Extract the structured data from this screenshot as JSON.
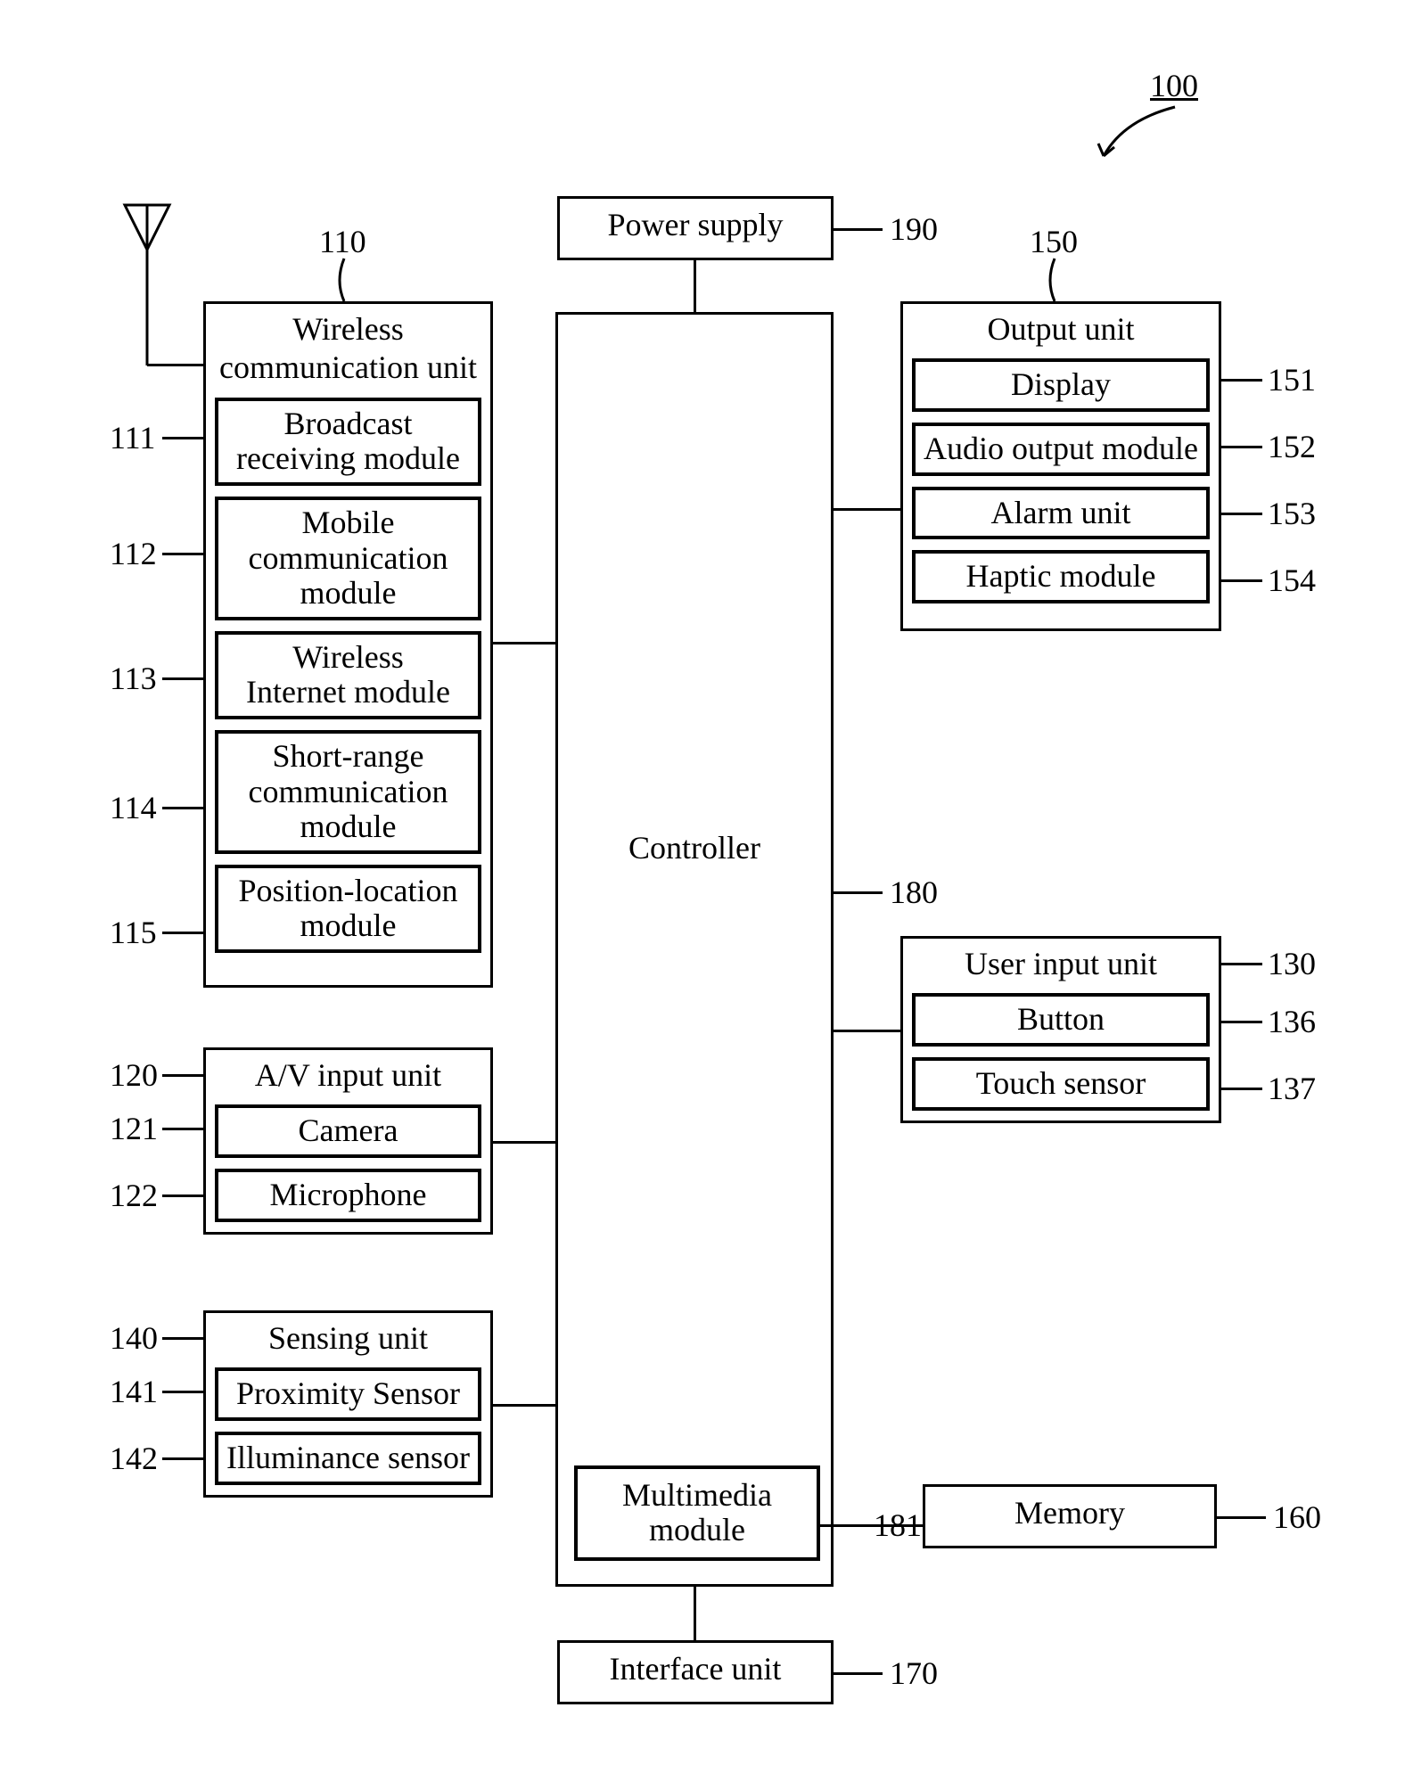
{
  "ref": {
    "r100": "100",
    "r110": "110",
    "r111": "111",
    "r112": "112",
    "r113": "113",
    "r114": "114",
    "r115": "115",
    "r120": "120",
    "r121": "121",
    "r122": "122",
    "r130": "130",
    "r136": "136",
    "r137": "137",
    "r140": "140",
    "r141": "141",
    "r142": "142",
    "r150": "150",
    "r151": "151",
    "r152": "152",
    "r153": "153",
    "r154": "154",
    "r160": "160",
    "r170": "170",
    "r180": "180",
    "r181": "181",
    "r190": "190"
  },
  "blocks": {
    "power_supply": "Power supply",
    "controller": "Controller",
    "multimedia_module_l1": "Multimedia",
    "multimedia_module_l2": "module",
    "interface_unit": "Interface unit",
    "memory": "Memory",
    "wireless_comm_unit_l1": "Wireless",
    "wireless_comm_unit_l2": "communication unit",
    "broadcast_rx_l1": "Broadcast",
    "broadcast_rx_l2": "receiving module",
    "mobile_comm_l1": "Mobile",
    "mobile_comm_l2": "communication",
    "mobile_comm_l3": "module",
    "wireless_internet_l1": "Wireless",
    "wireless_internet_l2": "Internet module",
    "short_range_l1": "Short-range",
    "short_range_l2": "communication",
    "short_range_l3": "module",
    "pos_loc_l1": "Position-location",
    "pos_loc_l2": "module",
    "av_input": "A/V input unit",
    "camera": "Camera",
    "microphone": "Microphone",
    "sensing_unit": "Sensing unit",
    "proximity": "Proximity Sensor",
    "illuminance": "Illuminance sensor",
    "output_unit": "Output unit",
    "display": "Display",
    "audio_out": "Audio output module",
    "alarm": "Alarm  unit",
    "haptic": "Haptic module",
    "user_input": "User input unit",
    "button": "Button",
    "touch_sensor": "Touch sensor"
  }
}
